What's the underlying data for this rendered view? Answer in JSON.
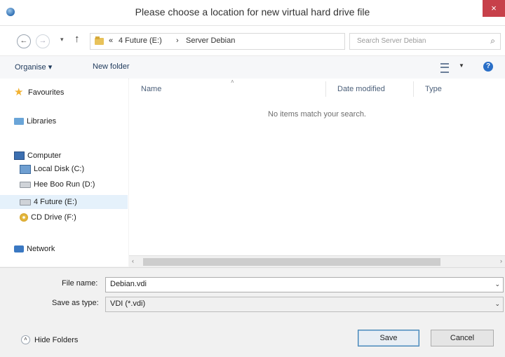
{
  "window": {
    "title": "Please choose a location for new virtual hard drive file",
    "close_glyph": "×"
  },
  "address": {
    "back_glyph": "←",
    "forward_glyph": "→",
    "recent_glyph": "▾",
    "up_glyph": "↑",
    "overflow": "«",
    "crumbs": [
      "4 Future (E:)",
      "Server Debian"
    ],
    "separator": "›",
    "dropdown_glyph": "⌄",
    "refresh_glyph": "↻"
  },
  "search": {
    "placeholder": "Search Server Debian",
    "icon_glyph": "⌕"
  },
  "toolbar": {
    "organise": "Organise ▾",
    "new_folder": "New folder",
    "view_drop": "▼",
    "help_glyph": "?"
  },
  "sidebar": {
    "favourites": "Favourites",
    "libraries": "Libraries",
    "computer": "Computer",
    "drives": [
      "Local Disk (C:)",
      "Hee Boo Run (D:)",
      "4 Future (E:)",
      "CD Drive (F:)"
    ],
    "network": "Network"
  },
  "columns": {
    "name": "Name",
    "date_modified": "Date modified",
    "type": "Type"
  },
  "content": {
    "empty_message": "No items match your search."
  },
  "scrollbar": {
    "left_glyph": "‹",
    "right_glyph": "›"
  },
  "form": {
    "file_name_label": "File name:",
    "file_name_value": "Debian.vdi",
    "save_type_label": "Save as type:",
    "save_type_value": "VDI (*.vdi)",
    "dropdown_glyph": "⌄"
  },
  "footer": {
    "hide_folders": "Hide Folders",
    "hide_glyph": "˄",
    "save": "Save",
    "cancel": "Cancel"
  },
  "colors": {
    "close": "#c7404a",
    "accent": "#2a6fc7",
    "selection": "#e5f1fb"
  }
}
